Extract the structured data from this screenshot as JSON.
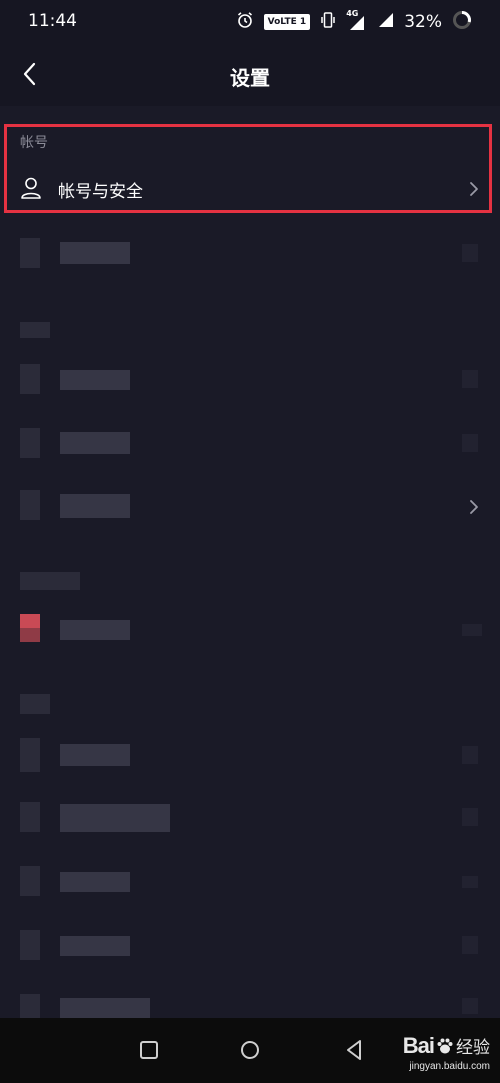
{
  "status_bar": {
    "time": "11:44",
    "volte_label": "VoLTE 1",
    "network_label": "4G",
    "battery_percent": "32%"
  },
  "header": {
    "title": "设置"
  },
  "sections": {
    "account": {
      "header": "帐号",
      "item_label": "帐号与安全"
    }
  },
  "colors": {
    "background": "#161622",
    "content_background": "#1a1a27",
    "highlight_border": "#e53242",
    "secondary_text": "#8b8b97"
  },
  "watermark": {
    "brand": "Bai",
    "brand_suffix": "经验",
    "url": "jingyan.baidu.com"
  }
}
